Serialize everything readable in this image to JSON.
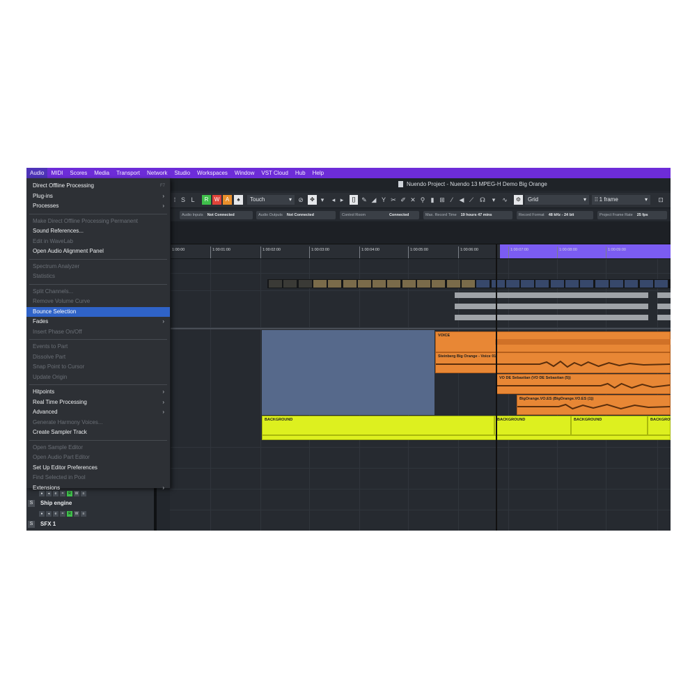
{
  "menubar": {
    "items": [
      "Audio",
      "MIDI",
      "Scores",
      "Media",
      "Transport",
      "Network",
      "Studio",
      "Workspaces",
      "Window",
      "VST Cloud",
      "Hub",
      "Help"
    ],
    "active": "Audio"
  },
  "title": "Nuendo Project - Nuendo 13 MPEG-H Demo Big Orange",
  "audio_menu": {
    "items": [
      {
        "label": "Direct Offline Processing",
        "enabled": true,
        "shortcut": "F7"
      },
      {
        "label": "Plug-ins",
        "enabled": true,
        "submenu": true
      },
      {
        "label": "Processes",
        "enabled": true,
        "submenu": true
      },
      {
        "label": "Make Direct Offline Processing Permanent",
        "enabled": false
      },
      {
        "label": "Sound References...",
        "enabled": true
      },
      {
        "label": "Edit in WaveLab",
        "enabled": false
      },
      {
        "label": "Open Audio Alignment Panel",
        "enabled": true
      },
      {
        "label": "Spectrum Analyzer",
        "enabled": false
      },
      {
        "label": "Statistics",
        "enabled": false
      },
      {
        "label": "Split Channels...",
        "enabled": false
      },
      {
        "label": "Remove Volume Curve",
        "enabled": false
      },
      {
        "label": "Bounce Selection",
        "enabled": true,
        "highlighted": true
      },
      {
        "label": "Fades",
        "enabled": true,
        "submenu": true
      },
      {
        "label": "Insert Phase On/Off",
        "enabled": false
      },
      {
        "label": "Events to Part",
        "enabled": false
      },
      {
        "label": "Dissolve Part",
        "enabled": false
      },
      {
        "label": "Snap Point to Cursor",
        "enabled": false
      },
      {
        "label": "Update Origin",
        "enabled": false
      },
      {
        "label": "Hitpoints",
        "enabled": true,
        "submenu": true
      },
      {
        "label": "Real Time Processing",
        "enabled": true,
        "submenu": true
      },
      {
        "label": "Advanced",
        "enabled": true,
        "submenu": true
      },
      {
        "label": "Generate Harmony Voices...",
        "enabled": false
      },
      {
        "label": "Create Sampler Track",
        "enabled": true
      },
      {
        "label": "Open Sample Editor",
        "enabled": false
      },
      {
        "label": "Open Audio Part Editor",
        "enabled": false
      },
      {
        "label": "Set Up Editor Preferences",
        "enabled": true
      },
      {
        "label": "Find Selected in Pool",
        "enabled": false
      },
      {
        "label": "Extensions",
        "enabled": true,
        "submenu": true
      }
    ]
  },
  "toolbar": {
    "read": "R",
    "write": "W",
    "auto": "A",
    "automation_mode": "Touch",
    "snap_type": "Grid",
    "quantize": "1 frame"
  },
  "status": {
    "audio_inputs_label": "Audio Inputs",
    "audio_inputs_value": "Not Connected",
    "audio_outputs_label": "Audio Outputs",
    "audio_outputs_value": "Not Connected",
    "control_room_label": "Control Room",
    "control_room_value": "Connected",
    "max_record_label": "Max. Record Time",
    "max_record_value": "19 hours 47 mins",
    "record_format_label": "Record Format",
    "record_format_value": "48 kHz - 24 bit",
    "frame_rate_label": "Project Frame Rate",
    "frame_rate_value": "25 fps"
  },
  "ruler": {
    "labels": [
      "1:00:00",
      "1:00:01:00",
      "1:00:02:00",
      "1:00:03:00",
      "1:00:04:00",
      "1:00:05:00",
      "1:00:06:00",
      "1:00:07:00",
      "1:00:08:00",
      "1:00:09:00"
    ]
  },
  "clips": {
    "voice": "VOICE",
    "steinberg": "Steinberg Big Orange - Voice 01",
    "vo_de": "VO DE Sebastian (VO DE Sebastian (5))",
    "vo_en": "BigOrange.VO.ES (BigOrange.VO.ES (1))",
    "background": "BACKGROUND"
  },
  "tracks": [
    {
      "name": "Ship engine",
      "solo": "S"
    },
    {
      "name": "SFX 1",
      "solo": "S"
    }
  ],
  "track_buttons": {
    "r": "R",
    "w": "W"
  },
  "colors": {
    "menubar": "#6d2cd8",
    "highlight": "#2f63c8",
    "clip_orange": "#e88735",
    "clip_yellow": "#ddf01f",
    "cycle": "#7b5cf2"
  }
}
